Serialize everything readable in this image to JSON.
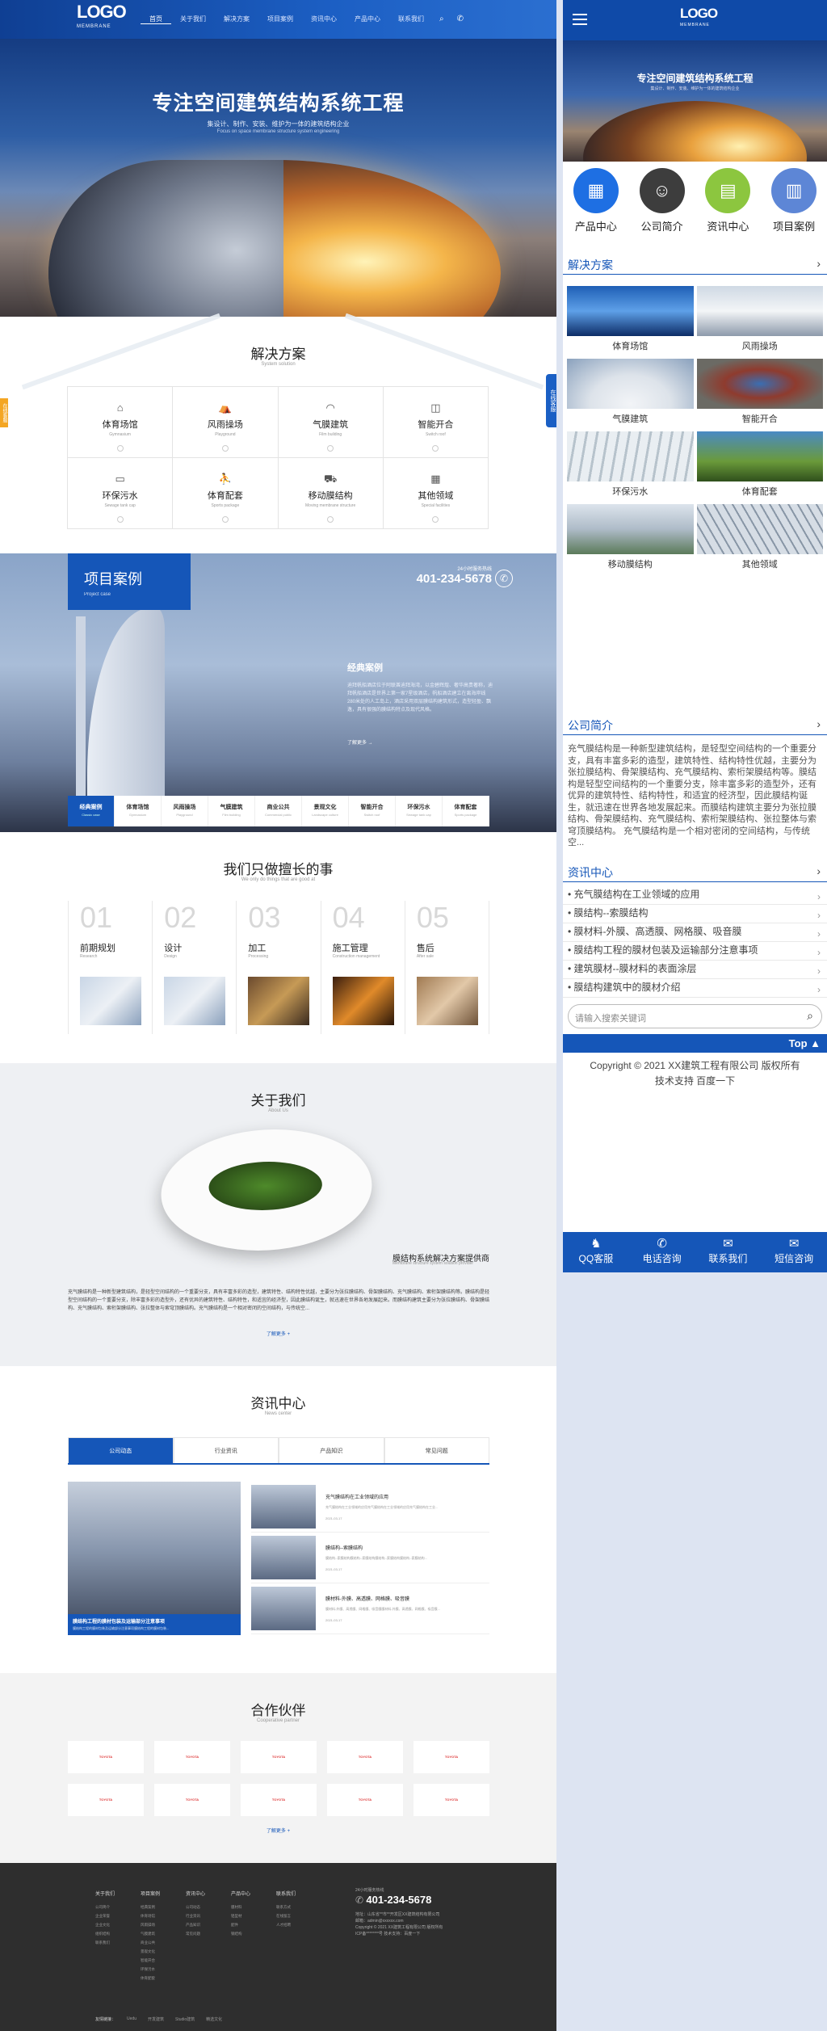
{
  "nav": {
    "logo": "LOGO",
    "logo_sub": "MEMBRANE",
    "items": [
      "首页",
      "关于我们",
      "解决方案",
      "项目案例",
      "资讯中心",
      "产品中心",
      "联系我们"
    ]
  },
  "hero": {
    "title": "专注空间建筑结构系统工程",
    "subtitle": "集设计、制作、安装、维护为一体的建筑结构企业",
    "subtitle_en": "Focus on space membrane structure system engineering"
  },
  "solutions": {
    "title": "解决方案",
    "subtitle": "System solution",
    "items": [
      {
        "icon": "stadium-icon",
        "label": "体育场馆",
        "en": "Gymnasium"
      },
      {
        "icon": "windrain-icon",
        "label": "风雨操场",
        "en": "Playground"
      },
      {
        "icon": "air-building-icon",
        "label": "气膜建筑",
        "en": "Film building"
      },
      {
        "icon": "smart-icon",
        "label": "智能开合",
        "en": "Switch roof"
      },
      {
        "icon": "sewage-icon",
        "label": "环保污水",
        "en": "Sewage tank cap"
      },
      {
        "icon": "sports-icon",
        "label": "体育配套",
        "en": "Sports package"
      },
      {
        "icon": "mobile-icon",
        "label": "移动膜结构",
        "en": "Moving membrane structure"
      },
      {
        "icon": "other-icon",
        "label": "其他领域",
        "en": "Special facilities"
      }
    ],
    "side_left": "在线客服",
    "side_right": "在线客服"
  },
  "cases": {
    "title": "项目案例",
    "subtitle": "Project case",
    "phone_label": "24小时服务热线",
    "phone": "401-234-5678",
    "featured_title": "经典案例",
    "featured_desc": "迪拜帆船酒店位于阿联酋迪拜海湾，以金碧辉煌、奢华高贵著称，迪拜帆船酒店是世界上第一家7星级酒店，帆船酒店建立在离海岸线280米处的人工岛上，酒店采用双层膜结构建筑形式，造型轻盈、飘逸，具有很强的膜结构特点及现代风格。",
    "more": "了解更多 →",
    "tabs": [
      {
        "label": "经典案例",
        "en": "Classic case"
      },
      {
        "label": "体育场馆",
        "en": "Gymnasium"
      },
      {
        "label": "风雨操场",
        "en": "Playground"
      },
      {
        "label": "气膜建筑",
        "en": "Film building"
      },
      {
        "label": "商业公共",
        "en": "Commercial public"
      },
      {
        "label": "景观文化",
        "en": "Landscape culture"
      },
      {
        "label": "智能开合",
        "en": "Switch roof"
      },
      {
        "label": "环保污水",
        "en": "Sewage tank cap"
      },
      {
        "label": "体育配套",
        "en": "Sports package"
      }
    ]
  },
  "good": {
    "title": "我们只做擅长的事",
    "subtitle": "We only do things that are good at",
    "steps": [
      {
        "num": "01",
        "label": "前期规划",
        "en": "Research"
      },
      {
        "num": "02",
        "label": "设计",
        "en": "Design"
      },
      {
        "num": "03",
        "label": "加工",
        "en": "Processing"
      },
      {
        "num": "04",
        "label": "施工管理",
        "en": "Construction management"
      },
      {
        "num": "05",
        "label": "售后",
        "en": "After sale"
      }
    ]
  },
  "about": {
    "title": "关于我们",
    "subtitle": "About Us",
    "caption": "膜结构系统解决方案提供商",
    "caption_en": "Membrane structure system solution provider",
    "text": "充气膜结构是一种新型建筑结构，是轻型空间结构的一个重要分支，具有丰富多彩的造型，建筑特性、结构特性优越，主要分为张拉膜结构、骨架膜结构、充气膜结构、索桁架膜结构等。膜结构是轻型空间结构的一个重要分支，除丰富多彩的造型外，还有优异的建筑特性、结构特性，和适宜的经济型，因此膜结构诞生，就迅速在世界各地发展起来。而膜结构建筑主要分为张拉膜结构、骨架膜结构、充气膜结构、索桁架膜结构、张拉整体与索穹顶膜结构。充气膜结构是一个相对密闭的空间结构，与传统空...",
    "more": "了解更多 +"
  },
  "news": {
    "title": "资讯中心",
    "subtitle": "News center",
    "tabs": [
      "公司动态",
      "行业资讯",
      "产品知识",
      "常见问题"
    ],
    "featured": "膜结构工程的膜材包装及运输部分注意事项",
    "featured_desc": "膜结构工程的膜材包装及运输部分注意事项膜结构工程的膜材包装...",
    "items": [
      {
        "title": "充气膜结构在工业领域的应用",
        "desc": "充气膜结构在工业领域的应用充气膜结构在工业领域的应用充气膜结构在工业...",
        "date": "2021-03-17"
      },
      {
        "title": "膜结构--索膜结构",
        "desc": "膜结构--索膜结构膜结构--索膜结构膜结构--索膜结构膜结构--索膜结构...",
        "date": "2021-03-17"
      },
      {
        "title": "膜材料-外膜、高透膜、网格膜、吸音膜",
        "desc": "膜材料-外膜、高透膜、网格膜、吸音膜膜材料-外膜、高透膜、网格膜、吸音膜...",
        "date": "2021-03-17"
      }
    ]
  },
  "partners": {
    "title": "合作伙伴",
    "subtitle": "Cooperative partner",
    "logo": "TOYOTA",
    "count": 10,
    "more": "了解更多 +"
  },
  "footer": {
    "cols": [
      {
        "head": "关于我们",
        "items": [
          "公司简介",
          "企业荣誉",
          "企业文化",
          "组织结构",
          "联系我们"
        ]
      },
      {
        "head": "项目案例",
        "items": [
          "经典案例",
          "体育场馆",
          "风雨操场",
          "气膜建筑",
          "商业公共",
          "景观文化",
          "智能开合",
          "环保污水",
          "体育配套"
        ]
      },
      {
        "head": "资讯中心",
        "items": [
          "公司动态",
          "行业资讯",
          "产品知识",
          "常见问题"
        ]
      },
      {
        "head": "产品中心",
        "items": [
          "膜材料",
          "铝型材",
          "配件",
          "钢结构"
        ]
      },
      {
        "head": "联系我们",
        "items": [
          "联系方式",
          "在线留言",
          "人才招聘"
        ]
      }
    ],
    "phone_label": "24小时服务热线",
    "phone": "401-234-5678",
    "addr": "地址：山东省**市**开发区XX建筑结构有限公司",
    "mail": "邮箱：admin@xxxxxx.com",
    "copy": "Copyright © 2021 XX建筑工程有限公司 版权所有",
    "icp": "ICP备********号 技术支持：百度一下",
    "links_label": "友情链接：",
    "links": [
      "Uedu",
      "开发建筑",
      "Studio建筑",
      "精选文化"
    ]
  },
  "mobile": {
    "banner_title": "专注空间建筑结构系统工程",
    "banner_sub": "集设计、制作、安装、维护为一体的建筑结构企业",
    "icons": [
      {
        "name": "product-icon",
        "label": "产品中心",
        "color": "#1e6fe3",
        "glyph": "▦"
      },
      {
        "name": "company-icon",
        "label": "公司简介",
        "color": "#3d3d3d",
        "glyph": "☺"
      },
      {
        "name": "news-icon",
        "label": "资讯中心",
        "color": "#8cc63f",
        "glyph": "▤"
      },
      {
        "name": "case-icon",
        "label": "项目案例",
        "color": "#5d86d6",
        "glyph": "▥"
      }
    ],
    "sol_title": "解决方案",
    "sol_items": [
      "体育场馆",
      "风雨操场",
      "气膜建筑",
      "智能开合",
      "环保污水",
      "体育配套",
      "移动膜结构",
      "其他领域"
    ],
    "about_title": "公司简介",
    "about_text": "充气膜结构是一种新型建筑结构，是轻型空间结构的一个重要分支，具有丰富多彩的造型，建筑特性、结构特性优越，主要分为张拉膜结构、骨架膜结构、充气膜结构、索桁架膜结构等。膜结构是轻型空间结构的一个重要分支，除丰富多彩的造型外，还有优异的建筑特性、结构特性，和适宜的经济型，因此膜结构诞生，就迅速在世界各地发展起来。而膜结构建筑主要分为张拉膜结构、骨架膜结构、充气膜结构、索桁架膜结构、张拉整体与索穹顶膜结构。 充气膜结构是一个相对密闭的空间结构，与传统空...",
    "news_title": "资讯中心",
    "news": [
      "充气膜结构在工业领域的应用",
      "膜结构--索膜结构",
      "膜材料-外膜、高透膜、网格膜、吸音膜",
      "膜结构工程的膜材包装及运输部分注意事项",
      "建筑膜材--膜材料的表面涂层",
      "膜结构建筑中的膜材介绍"
    ],
    "search_placeholder": "请输入搜索关键词",
    "top": "Top ▲",
    "copy1": "Copyright © 2021 XX建筑工程有限公司 版权所有",
    "copy2": "技术支持 百度一下",
    "bar": [
      {
        "icon": "qq-icon",
        "glyph": "♞",
        "label": "QQ客服"
      },
      {
        "icon": "phone-icon",
        "glyph": "✆",
        "label": "电话咨询"
      },
      {
        "icon": "chat-icon",
        "glyph": "✉",
        "label": "联系我们"
      },
      {
        "icon": "sms-icon",
        "glyph": "✉",
        "label": "短信咨询"
      }
    ]
  },
  "colors": {
    "brand": "#1556b8",
    "nav": "#0f4aa8",
    "page_bg": "#dde4f2"
  }
}
